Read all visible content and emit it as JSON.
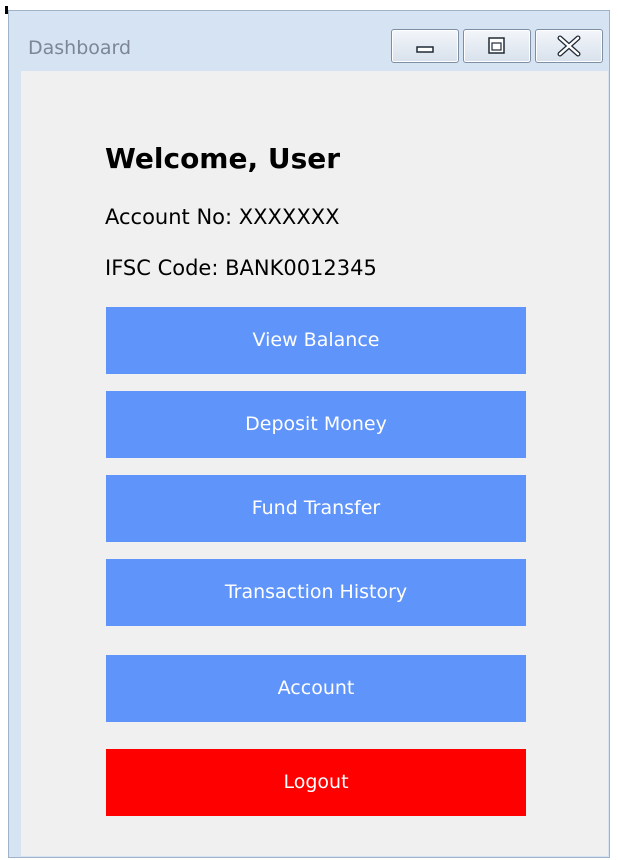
{
  "window": {
    "title": "Dashboard",
    "controls": {
      "minimize": "minimize-icon",
      "maximize": "maximize-icon",
      "close": "close-icon"
    }
  },
  "header": {
    "welcome": "Welcome, User",
    "account_no": "Account No: XXXXXXX",
    "ifsc_code": "IFSC Code: BANK0012345"
  },
  "actions": {
    "view_balance": "View Balance",
    "deposit_money": "Deposit Money",
    "fund_transfer": "Fund Transfer",
    "transaction_history": "Transaction History",
    "account": "Account",
    "logout": "Logout"
  },
  "colors": {
    "primary_button": "#5f94fb",
    "logout_button": "#ff0000",
    "background": "#f0f0f0",
    "frame": "#d5e3f2"
  }
}
